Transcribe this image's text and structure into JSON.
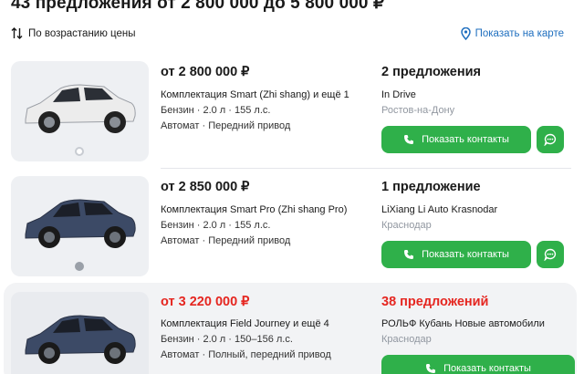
{
  "heading": "43 предложения от 2 800 000 до 5 800 000 ₽",
  "sort_label": "По возрастанию цены",
  "map_link": "Показать на карте",
  "colors": {
    "accent_green": "#2fb04a",
    "price_red": "#e52620",
    "link_blue": "#1f6fbf"
  },
  "listings": [
    {
      "price": "от 2 800 000 ₽",
      "trim": "Комплектация Smart (Zhi shang) и ещё 1",
      "specs": "Бензин · 2.0 л · 155 л.с.",
      "transmission": "Автомат · Передний привод",
      "offers": "2 предложения",
      "seller": "In Drive",
      "city": "Ростов-на-Дону",
      "contacts_label": "Показать контакты",
      "car_color": "#ececec"
    },
    {
      "price": "от 2 850 000 ₽",
      "trim": "Комплектация Smart Pro (Zhi shang Pro)",
      "specs": "Бензин · 2.0 л · 155 л.с.",
      "transmission": "Автомат · Передний привод",
      "offers": "1 предложение",
      "seller": "LiXiang Li Auto Krasnodar",
      "city": "Краснодар",
      "contacts_label": "Показать контакты",
      "car_color": "#3c4a66"
    },
    {
      "price": "от 3 220 000 ₽",
      "trim": "Комплектация Field Journey и ещё 4",
      "specs": "Бензин · 2.0 л · 150–156 л.с.",
      "transmission": "Автомат · Полный, передний привод",
      "offers": "38 предложений",
      "seller": "РОЛЬФ Кубань Новые автомобили",
      "city": "Краснодар",
      "contacts_label": "Показать контакты",
      "car_color": "#3c4a66"
    }
  ]
}
